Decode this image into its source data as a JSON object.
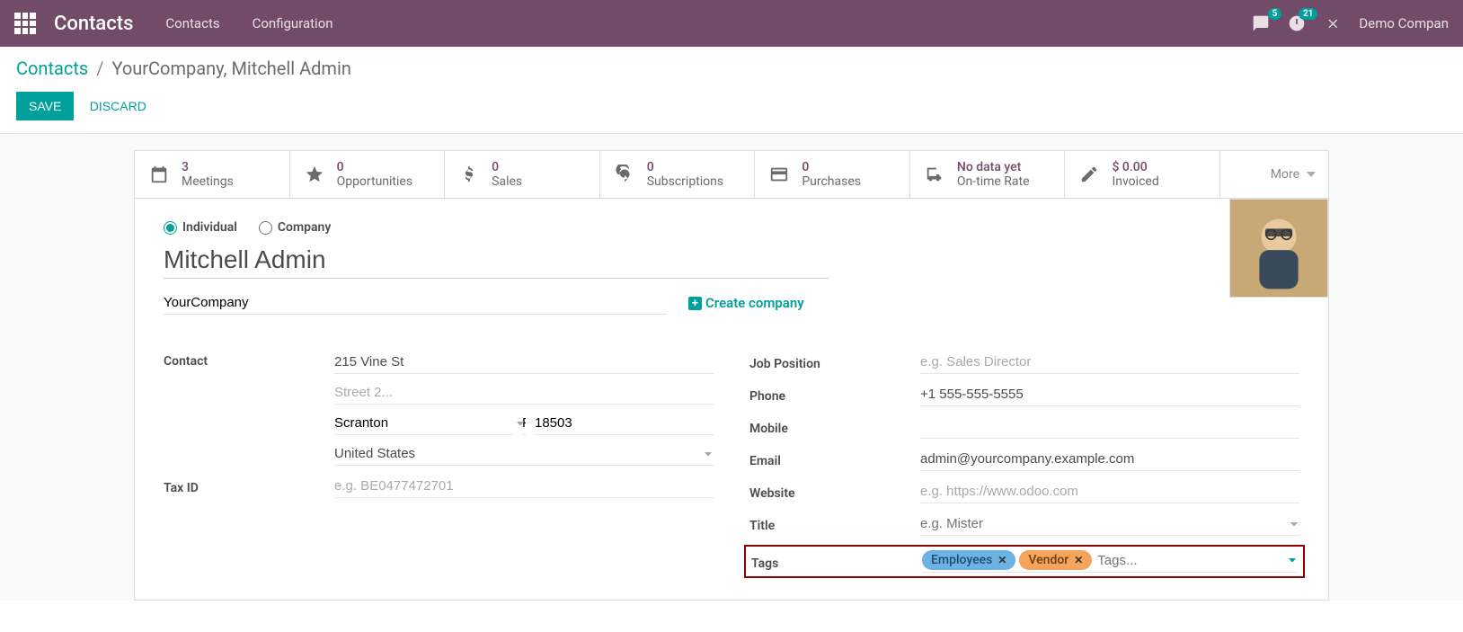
{
  "nav": {
    "brand": "Contacts",
    "links": [
      "Contacts",
      "Configuration"
    ],
    "msg_badge": "5",
    "clock_badge": "21",
    "company": "Demo Compan"
  },
  "breadcrumb": {
    "root": "Contacts",
    "current": "YourCompany, Mitchell Admin"
  },
  "actions": {
    "save": "SAVE",
    "discard": "DISCARD"
  },
  "stats": [
    {
      "value": "3",
      "label": "Meetings"
    },
    {
      "value": "0",
      "label": "Opportunities"
    },
    {
      "value": "0",
      "label": "Sales"
    },
    {
      "value": "0",
      "label": "Subscriptions"
    },
    {
      "value": "0",
      "label": "Purchases"
    },
    {
      "value": "No data yet",
      "label": "On-time Rate"
    },
    {
      "value": "$ 0.00",
      "label": "Invoiced"
    }
  ],
  "more_label": "More",
  "contact_type": {
    "individual": "Individual",
    "company": "Company"
  },
  "name": "Mitchell Admin",
  "company_name": "YourCompany",
  "create_company_label": "Create company",
  "address": {
    "label": "Contact",
    "street": "215 Vine St",
    "street2_placeholder": "Street 2...",
    "city": "Scranton",
    "state": "Pennsylvania (US)",
    "zip": "18503",
    "country": "United States"
  },
  "tax_id": {
    "label": "Tax ID",
    "placeholder": "e.g. BE0477472701"
  },
  "right": {
    "job_label": "Job Position",
    "job_placeholder": "e.g. Sales Director",
    "phone_label": "Phone",
    "phone": "+1 555-555-5555",
    "mobile_label": "Mobile",
    "email_label": "Email",
    "email": "admin@yourcompany.example.com",
    "website_label": "Website",
    "website_placeholder": "e.g. https://www.odoo.com",
    "title_label": "Title",
    "title_placeholder": "e.g. Mister",
    "tags_label": "Tags",
    "tags_placeholder": "Tags...",
    "tags": [
      "Employees",
      "Vendor"
    ]
  }
}
